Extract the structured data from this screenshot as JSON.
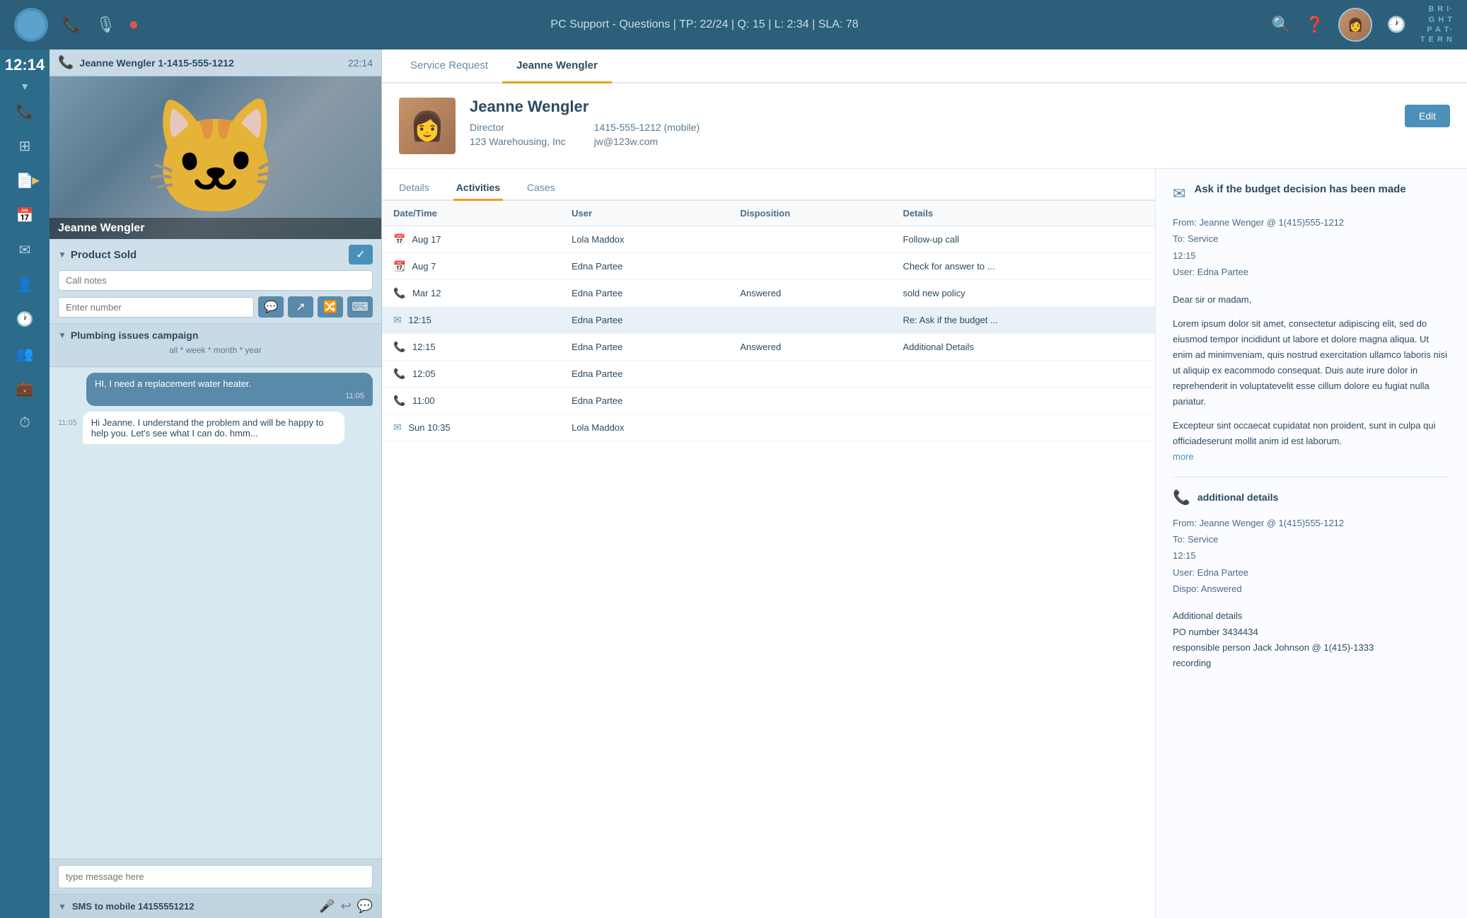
{
  "topbar": {
    "title": "PC Support - Questions  |  TP: 22/24  |  Q: 15  |  L: 2:34  |  SLA: 78",
    "brand": "BRIGHT\nPATTERN",
    "icons": {
      "phone": "📞",
      "mute": "🎙",
      "record": "⏺"
    }
  },
  "sidebar": {
    "time": "12:14",
    "items": [
      {
        "name": "phone",
        "icon": "📞",
        "label": "Phone"
      },
      {
        "name": "grid",
        "icon": "⊞",
        "label": "Grid"
      },
      {
        "name": "pages",
        "icon": "📄",
        "label": "Pages",
        "badge": ""
      },
      {
        "name": "calendar",
        "icon": "📅",
        "label": "Calendar"
      },
      {
        "name": "email",
        "icon": "✉",
        "label": "Email"
      },
      {
        "name": "contacts",
        "icon": "👤",
        "label": "Contacts"
      },
      {
        "name": "history",
        "icon": "🕐",
        "label": "History"
      },
      {
        "name": "supervisor",
        "icon": "👥",
        "label": "Supervisor"
      },
      {
        "name": "cases",
        "icon": "💼",
        "label": "Cases"
      },
      {
        "name": "dashboard",
        "icon": "⏱",
        "label": "Dashboard"
      }
    ]
  },
  "call_header": {
    "name": "Jeanne Wengler 1-1415-555-1212",
    "time": "22:14",
    "icon": "📞"
  },
  "contact_image": {
    "name": "Jeanne Wengler"
  },
  "product_sold": {
    "label": "Product Sold",
    "call_notes_placeholder": "Call notes",
    "enter_number_placeholder": "Enter number"
  },
  "campaign": {
    "label": "Plumbing issues campaign",
    "filter": "all * week * month * year"
  },
  "chat": {
    "messages": [
      {
        "type": "right",
        "text": "HI, I need a replacement water heater.",
        "time": "11:05"
      },
      {
        "type": "left",
        "time": "11:05",
        "text": "Hi Jeanne. I understand the problem and will be happy to help you. Let's see what I can do. hmm..."
      }
    ],
    "input_placeholder": "type message here"
  },
  "sms": {
    "label": "SMS to mobile 14155551212"
  },
  "main_tabs": [
    {
      "label": "Service Request",
      "active": false
    },
    {
      "label": "Jeanne Wengler",
      "active": true
    }
  ],
  "contact": {
    "name": "Jeanne Wengler",
    "title": "Director",
    "company": "123 Warehousing, Inc",
    "phone": "1415-555-1212 (mobile)",
    "email": "jw@123w.com",
    "edit_label": "Edit"
  },
  "activities_tabs": [
    {
      "label": "Details",
      "active": false
    },
    {
      "label": "Activities",
      "active": true
    },
    {
      "label": "Cases",
      "active": false
    }
  ],
  "activities_table": {
    "columns": [
      "Date/Time",
      "User",
      "Disposition",
      "Details"
    ],
    "rows": [
      {
        "icon": "calendar",
        "date": "Aug 17",
        "user": "Lola Maddox",
        "disposition": "",
        "details": "Follow-up call",
        "highlighted": false
      },
      {
        "icon": "calendar-orange",
        "date": "Aug 7",
        "user": "Edna Partee",
        "disposition": "",
        "details": "Check for answer to ...",
        "highlighted": false
      },
      {
        "icon": "phone",
        "date": "Mar 12",
        "user": "Edna Partee",
        "disposition": "Answered",
        "details": "sold new policy",
        "highlighted": false
      },
      {
        "icon": "email",
        "date": "12:15",
        "user": "Edna Partee",
        "disposition": "",
        "details": "Re: Ask if the budget ...",
        "highlighted": true
      },
      {
        "icon": "phone",
        "date": "12:15",
        "user": "Edna Partee",
        "disposition": "Answered",
        "details": "Additional Details",
        "highlighted": false
      },
      {
        "icon": "phone",
        "date": "12:05",
        "user": "Edna Partee",
        "disposition": "",
        "details": "",
        "highlighted": false
      },
      {
        "icon": "phone",
        "date": "11:00",
        "user": "Edna Partee",
        "disposition": "",
        "details": "",
        "highlighted": false
      },
      {
        "icon": "email-fancy",
        "date": "Sun 10:35",
        "user": "Lola Maddox",
        "disposition": "",
        "details": "",
        "highlighted": false
      }
    ]
  },
  "detail_panel": {
    "email_title": "Ask if the budget decision has been made",
    "email_meta": "From: Jeanne Wenger @ 1(415)555-1212\nTo: Service\n12:15\nUser: Edna Partee",
    "email_salutation": "Dear sir or madam,",
    "email_body": "Lorem ipsum dolor sit amet, consectetur adipiscing elit, sed do eiusmod tempor incididunt ut labore et dolore magna aliqua. Ut enim ad minimveniam, quis nostrud exercitation ullamco laboris nisi ut aliquip ex eacommodo consequat. Duis aute irure dolor in reprehenderit in voluptatevelit esse cillum dolore eu fugiat nulla pariatur.",
    "email_body2": "Excepteur sint occaecat cupidatat non proident, sunt in culpa qui officiadeserunt mollit anim id est laborum.",
    "email_more": "more",
    "additional_title": "additional details",
    "additional_meta": "From: Jeanne Wenger @ 1(415)555-1212\nTo: Service\n12:15\nUser: Edna Partee\nDispo: Answered",
    "additional_body": "Additional details\nPO number 3434434\nresponsible person Jack Johnson @ 1(415)-1333\nrecording"
  }
}
